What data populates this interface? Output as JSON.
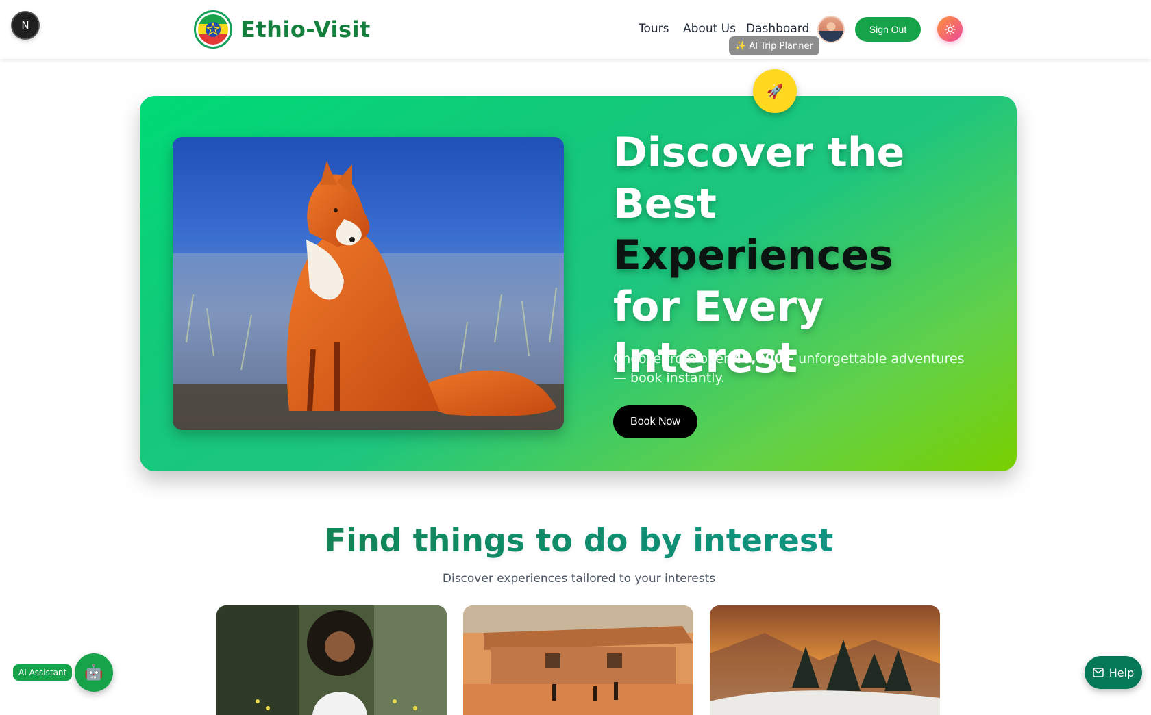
{
  "header": {
    "badge": "N",
    "brand": "Ethio-Visit",
    "nav": [
      "Tours",
      "About Us",
      "Dashboard"
    ],
    "tooltip": "✨ AI Trip Planner",
    "sign_out": "Sign Out",
    "theme_icon": "sun-icon"
  },
  "hero": {
    "rocket_icon": "🚀",
    "title_line1": "Discover the Best",
    "title_line2": "Experiences",
    "title_line3": "for Every",
    "title_line4": "Interest",
    "subtitle_pre": "Choose from over ",
    "subtitle_strong": "40,000+",
    "subtitle_post": " unforgettable adventures — book instantly.",
    "button": "Book Now"
  },
  "section": {
    "title": "Find things to do by interest",
    "subtitle": "Discover experiences tailored to your interests"
  },
  "widgets": {
    "ai_label": "AI Assistant",
    "ai_icon": "🤖",
    "help_label": "Help"
  },
  "colors": {
    "brand": "#15803d",
    "accent": "#16a34a",
    "rocket": "#ffd81f"
  }
}
